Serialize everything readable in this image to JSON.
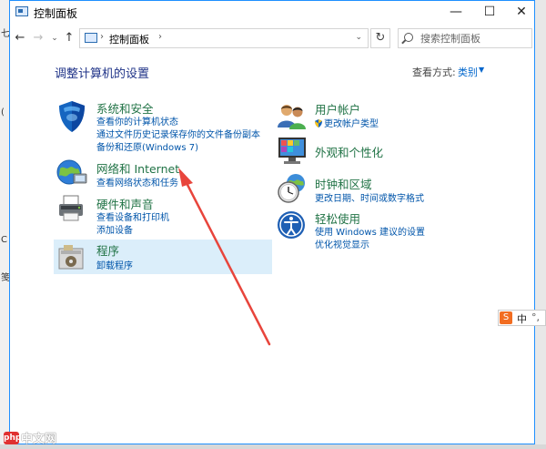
{
  "window": {
    "title": "控制面板",
    "controls": {
      "minimize": "—",
      "maximize": "☐",
      "close": "✕"
    }
  },
  "address_bar": {
    "nav": {
      "back": "←",
      "forward": "→",
      "recent": "⌄",
      "up": "↑"
    },
    "sep": "›",
    "path": "控制面板",
    "dropdown": "⌄",
    "refresh": "↻",
    "search_placeholder": "搜索控制面板"
  },
  "main": {
    "title": "调整计算机的设置",
    "view_by_label": "查看方式:",
    "view_by_value": "类别",
    "view_by_caret": "▼",
    "categories_left": [
      {
        "title": "系统和安全",
        "icon": "shield-icon",
        "links": [
          "查看你的计算机状态",
          "通过文件历史记录保存你的文件备份副本",
          "备份和还原(Windows 7)"
        ]
      },
      {
        "title": "网络和 Internet",
        "icon": "network-globe-icon",
        "links": [
          "查看网络状态和任务"
        ]
      },
      {
        "title": "硬件和声音",
        "icon": "printer-icon",
        "links": [
          "查看设备和打印机",
          "添加设备"
        ]
      },
      {
        "title": "程序",
        "icon": "programs-icon",
        "links": [
          "卸载程序"
        ]
      }
    ],
    "categories_right": [
      {
        "title": "用户帐户",
        "icon": "users-icon",
        "links": [
          "更改帐户类型"
        ]
      },
      {
        "title": "外观和个性化",
        "icon": "monitor-icon",
        "links": []
      },
      {
        "title": "时钟和区域",
        "icon": "clock-globe-icon",
        "links": [
          "更改日期、时间或数字格式"
        ]
      },
      {
        "title": "轻松使用",
        "icon": "ease-of-access-icon",
        "links": [
          "使用 Windows 建议的设置",
          "优化视觉显示"
        ]
      }
    ]
  },
  "background": {
    "left_edge_char": "七",
    "left_edge_char2": "(",
    "left_edge_char3": "C",
    "left_edge_char4": "笺"
  },
  "ime": {
    "logo": "S",
    "label": "中",
    "extra": "°,"
  },
  "watermark": {
    "logo": "php",
    "text": "中文网"
  },
  "colors": {
    "window_border": "#1e90ff",
    "category_title": "#217346",
    "link": "#0055aa",
    "page_title": "#1e3287",
    "arrow": "#e8453c",
    "selected_bg": "#dbeefa"
  }
}
